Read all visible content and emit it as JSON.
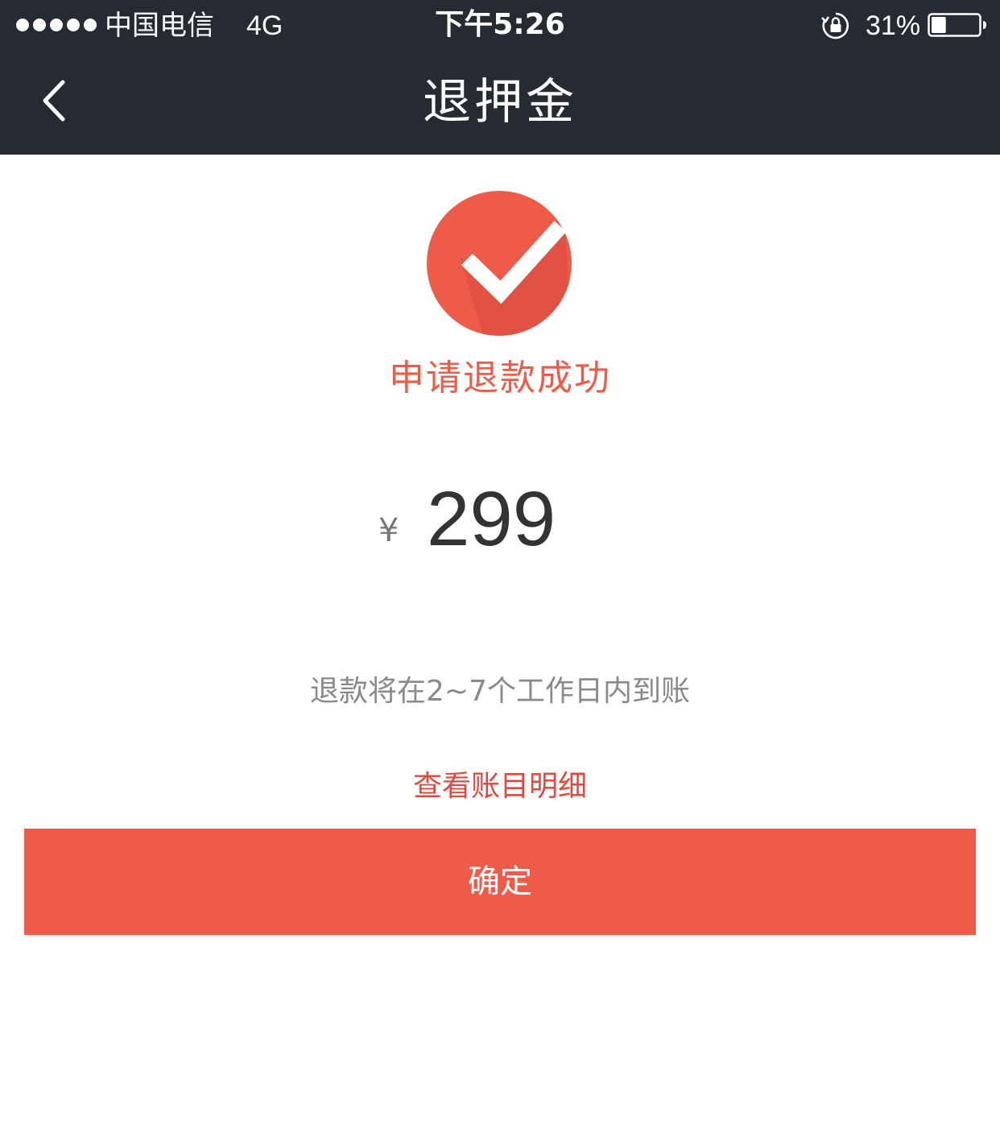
{
  "status_bar": {
    "carrier": "中国电信",
    "network": "4G",
    "time": "下午5:26",
    "battery_percent": "31%",
    "battery_level": 0.31,
    "lock_icon": "rotation-lock-icon",
    "battery_icon": "battery-icon",
    "signal_icon": "signal-dots-icon"
  },
  "nav": {
    "title": "退押金",
    "back_icon": "chevron-left-icon"
  },
  "result": {
    "icon": "checkmark-circle-icon",
    "message": "申请退款成功",
    "currency_symbol": "¥",
    "amount": "299",
    "notice": "退款将在2~7个工作日内到账",
    "details_link": "查看账目明细"
  },
  "actions": {
    "confirm_label": "确定"
  },
  "colors": {
    "header_bg": "#262a33",
    "accent": "#f05a48",
    "accent_text": "#e4473d"
  }
}
